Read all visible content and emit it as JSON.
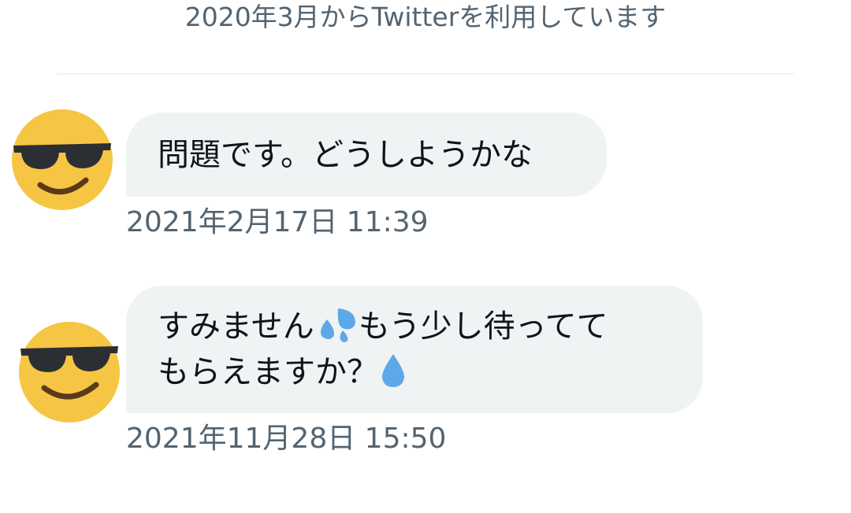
{
  "header": {
    "joined_text": "2020年3月からTwitterを利用しています"
  },
  "messages": [
    {
      "text": "問題です。どうしようかな",
      "timestamp": "2021年2月17日 11:39",
      "avatar_icon": "sunglasses-face-icon"
    },
    {
      "line1_a": "すみません",
      "line1_b": "もう少し待ってて",
      "line2": "もらえますか？",
      "emoji_1": "sweat-droplets-icon",
      "emoji_2": "droplet-icon",
      "timestamp": "2021年11月28日 15:50",
      "avatar_icon": "sunglasses-face-icon"
    }
  ],
  "colors": {
    "bubble_bg": "#eff3f4",
    "secondary_text": "#536471",
    "primary_text": "#0f1419",
    "emoji_yellow": "#f6c543",
    "droplet_blue": "#5da8e8"
  }
}
